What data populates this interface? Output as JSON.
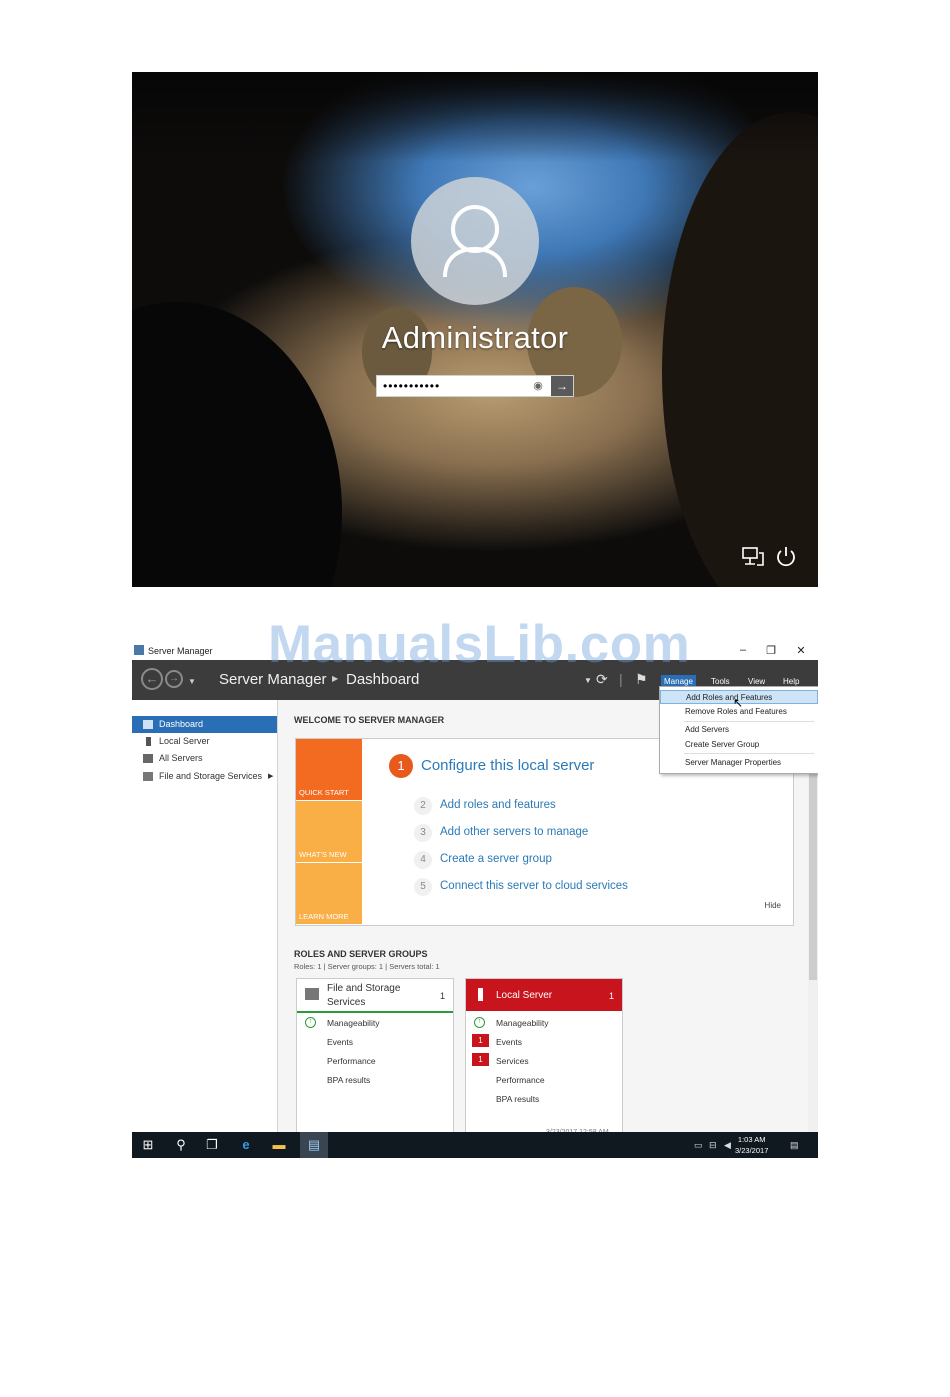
{
  "login": {
    "username": "Administrator",
    "password_value": "•••••••••••",
    "reveal_icon": "eye-icon",
    "submit_icon": "arrow-right-icon",
    "bottom_icons": [
      "network-icon",
      "power-icon"
    ]
  },
  "watermark": "ManualsLib.com",
  "server_manager": {
    "window_title": "Server Manager",
    "window_controls": [
      "–",
      "❐",
      "✕"
    ],
    "breadcrumb": {
      "app": "Server Manager",
      "page": "Dashboard"
    },
    "menu": [
      "Manage",
      "Tools",
      "View",
      "Help"
    ],
    "manage_dropdown": [
      "Add Roles and Features",
      "Remove Roles and Features",
      "Add Servers",
      "Create Server Group",
      "Server Manager Properties"
    ],
    "sidebar": [
      {
        "label": "Dashboard"
      },
      {
        "label": "Local Server"
      },
      {
        "label": "All Servers"
      },
      {
        "label": "File and Storage Services"
      }
    ],
    "welcome": {
      "title": "WELCOME TO SERVER MANAGER",
      "tiles": [
        "QUICK START",
        "WHAT'S NEW",
        "LEARN MORE"
      ],
      "steps": [
        {
          "num": "1",
          "text": "Configure this local server"
        },
        {
          "num": "2",
          "text": "Add roles and features"
        },
        {
          "num": "3",
          "text": "Add other servers to manage"
        },
        {
          "num": "4",
          "text": "Create a server group"
        },
        {
          "num": "5",
          "text": "Connect this server to cloud services"
        }
      ],
      "hide": "Hide"
    },
    "roles": {
      "title": "ROLES AND SERVER GROUPS",
      "subtitle": "Roles: 1   |   Server groups: 1   |   Servers total: 1",
      "cards": [
        {
          "title_line1": "File and Storage",
          "title_line2": "Services",
          "count": "1",
          "rows": [
            "Manageability",
            "Events",
            "Performance",
            "BPA results"
          ]
        },
        {
          "title": "Local Server",
          "count": "1",
          "rows": [
            "Manageability",
            "Events",
            "Services",
            "Performance",
            "BPA results"
          ],
          "events_badge": "1",
          "services_badge": "1",
          "timestamp": "3/23/2017 12:58 AM"
        }
      ]
    },
    "taskbar": {
      "time": "1:03 AM",
      "date": "3/23/2017"
    },
    "colors": {
      "accent": "#2a6eb5",
      "quick_start": "#f26b21",
      "tile_secondary": "#f9ae46",
      "alert_red": "#c8141c",
      "ok_green": "#2f9a3a"
    }
  }
}
